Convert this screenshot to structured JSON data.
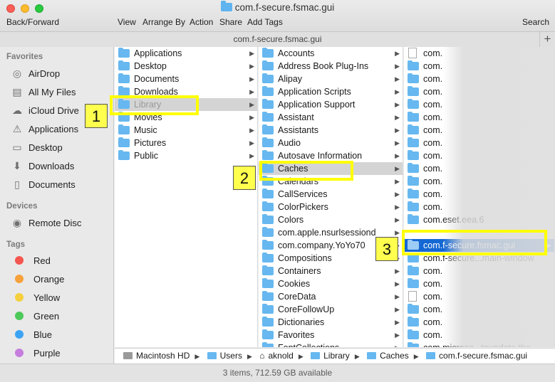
{
  "window": {
    "title": "com.f-secure.fsmac.gui"
  },
  "toolbar": {
    "back_forward": "Back/Forward",
    "view": "View",
    "arrange_by": "Arrange By",
    "action": "Action",
    "share": "Share",
    "add_tags": "Add Tags",
    "search": "Search"
  },
  "path_header": "com.f-secure.fsmac.gui",
  "plus": "+",
  "sidebar": {
    "favorites_label": "Favorites",
    "favorites": [
      "AirDrop",
      "All My Files",
      "iCloud Drive",
      "Applications",
      "Desktop",
      "Downloads",
      "Documents"
    ],
    "devices_label": "Devices",
    "devices": [
      "Remote Disc"
    ],
    "tags_label": "Tags",
    "tags": [
      {
        "label": "Red",
        "color": "#f4564f"
      },
      {
        "label": "Orange",
        "color": "#f6a13b"
      },
      {
        "label": "Yellow",
        "color": "#f5cf3d"
      },
      {
        "label": "Green",
        "color": "#4fc85a"
      },
      {
        "label": "Blue",
        "color": "#3ca3f3"
      },
      {
        "label": "Purple",
        "color": "#c57ede"
      }
    ]
  },
  "columns": {
    "col1": [
      "Applications",
      "Desktop",
      "Documents",
      "Downloads",
      "Library",
      "Movies",
      "Music",
      "Pictures",
      "Public"
    ],
    "col2": [
      "Accounts",
      "Address Book Plug-Ins",
      "Alipay",
      "Application Scripts",
      "Application Support",
      "Assistant",
      "Assistants",
      "Audio",
      "Autosave Information",
      "Caches",
      "Calendars",
      "CallServices",
      "ColorPickers",
      "Colors",
      "com.apple.nsurlsessiond",
      "com.company.YoYo70",
      "Compositions",
      "Containers",
      "Cookies",
      "CoreData",
      "CoreFollowUp",
      "Dictionaries",
      "Favorites",
      "FontCollections"
    ],
    "col3": [
      "com.",
      "com.",
      "com.",
      "com.",
      "com.",
      "com.",
      "com.",
      "com.",
      "com.",
      "com.",
      "com.",
      "com.",
      "com.",
      "com.eset.eea.6",
      "com.f-secure.fsmac.gui",
      "com.f-secure...main-window",
      "com.",
      "com.",
      "com.",
      "com.",
      "com.",
      "com.",
      "com.",
      "com.microso...toundate.tha"
    ]
  },
  "annotations": [
    "1",
    "2",
    "3"
  ],
  "path_bar": [
    "Macintosh HD",
    "Users",
    "aknold",
    "Library",
    "Caches",
    "com.f-secure.fsmac.gui"
  ],
  "status": "3 items, 712.59 GB available"
}
